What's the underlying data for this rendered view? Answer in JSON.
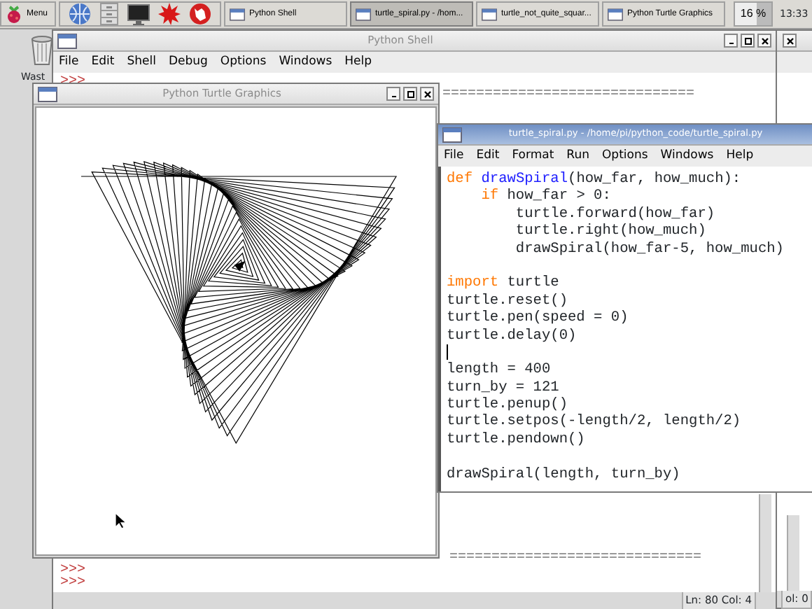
{
  "taskbar": {
    "menu_label": "Menu",
    "tasks": [
      {
        "label": "Python Shell",
        "selected": false
      },
      {
        "label": "turtle_spiral.py - /hom...",
        "selected": true
      },
      {
        "label": "turtle_not_quite_squar...",
        "selected": false
      },
      {
        "label": "Python Turtle Graphics",
        "selected": false
      }
    ],
    "cpu": "16 %",
    "clock": "13:33"
  },
  "desktop": {
    "icon_label": "Wast"
  },
  "shell": {
    "title": "Python Shell",
    "active": false,
    "menu": [
      "File",
      "Edit",
      "Shell",
      "Debug",
      "Options",
      "Windows",
      "Help"
    ],
    "top_lines": [
      {
        "text": ">>>",
        "kind": "prompt"
      },
      {
        "text": "==============================",
        "kind": "output"
      }
    ],
    "bottom_lines": [
      {
        "text": "==============================",
        "kind": "output"
      },
      {
        "text": ">>>",
        "kind": "prompt"
      },
      {
        "text": ">>>",
        "kind": "prompt"
      }
    ],
    "status": "Ln: 80 Col: 4"
  },
  "back_window": {
    "status": "ol: 0"
  },
  "turtle_window": {
    "title": "Python Turtle Graphics",
    "active": false
  },
  "editor": {
    "title": "turtle_spiral.py - /home/pi/python_code/turtle_spiral.py",
    "active": true,
    "menu": [
      "File",
      "Edit",
      "Format",
      "Run",
      "Options",
      "Windows",
      "Help"
    ],
    "code": [
      {
        "kind": "code",
        "tokens": [
          {
            "text": "def",
            "kind": "keyword"
          },
          {
            "text": " drawSpiral",
            "kind": "definition"
          },
          {
            "text": "(how_far, how_much):",
            "kind": "plain"
          }
        ]
      },
      {
        "kind": "code",
        "tokens": [
          {
            "text": "    if",
            "kind": "keyword"
          },
          {
            "text": " how_far > 0:",
            "kind": "plain"
          }
        ]
      },
      {
        "kind": "code",
        "tokens": [
          {
            "text": "        turtle.forward(how_far)",
            "kind": "plain"
          }
        ]
      },
      {
        "kind": "code",
        "tokens": [
          {
            "text": "        turtle.right(how_much)",
            "kind": "plain"
          }
        ]
      },
      {
        "kind": "code",
        "tokens": [
          {
            "text": "        drawSpiral(how_far-5, how_much)",
            "kind": "plain"
          }
        ]
      },
      {
        "kind": "blank"
      },
      {
        "kind": "code",
        "tokens": [
          {
            "text": "import",
            "kind": "keyword"
          },
          {
            "text": " turtle",
            "kind": "plain"
          }
        ]
      },
      {
        "kind": "code",
        "tokens": [
          {
            "text": "turtle.reset()",
            "kind": "plain"
          }
        ]
      },
      {
        "kind": "code",
        "tokens": [
          {
            "text": "turtle.pen(speed = 0)",
            "kind": "plain"
          }
        ]
      },
      {
        "kind": "code",
        "tokens": [
          {
            "text": "turtle.delay(0)",
            "kind": "plain"
          }
        ]
      },
      {
        "kind": "caret"
      },
      {
        "kind": "code",
        "tokens": [
          {
            "text": "length = 400",
            "kind": "plain"
          }
        ]
      },
      {
        "kind": "code",
        "tokens": [
          {
            "text": "turn_by = 121",
            "kind": "plain"
          }
        ]
      },
      {
        "kind": "code",
        "tokens": [
          {
            "text": "turtle.penup()",
            "kind": "plain"
          }
        ]
      },
      {
        "kind": "code",
        "tokens": [
          {
            "text": "turtle.setpos(-length/2, length/2)",
            "kind": "plain"
          }
        ]
      },
      {
        "kind": "code",
        "tokens": [
          {
            "text": "turtle.pendown()",
            "kind": "plain"
          }
        ]
      },
      {
        "kind": "blank"
      },
      {
        "kind": "code",
        "tokens": [
          {
            "text": "drawSpiral(length, turn_by)",
            "kind": "plain"
          }
        ]
      }
    ]
  }
}
